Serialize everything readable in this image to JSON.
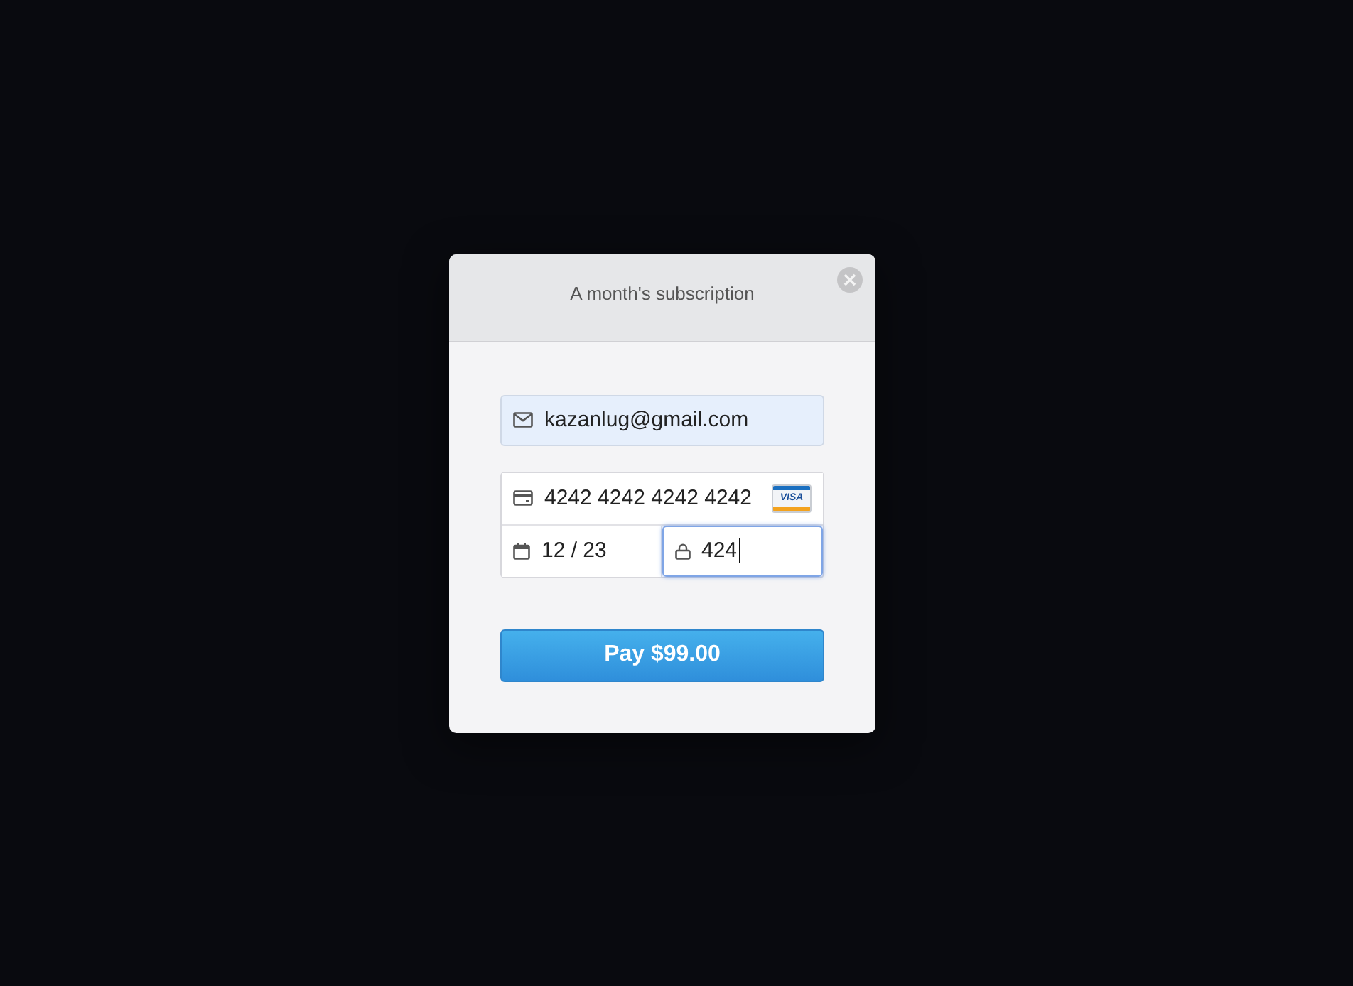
{
  "dialog": {
    "title": "A month's subscription"
  },
  "email": {
    "value": "kazanlug@gmail.com",
    "autofilled": true,
    "focused": false
  },
  "card": {
    "number": {
      "value": "4242 4242 4242 4242",
      "focused": false
    },
    "brand": "VISA",
    "expiry": {
      "value": "12 / 23",
      "focused": false
    },
    "cvc": {
      "value": "424",
      "focused": true
    }
  },
  "pay_button": {
    "label": "Pay $99.00"
  }
}
